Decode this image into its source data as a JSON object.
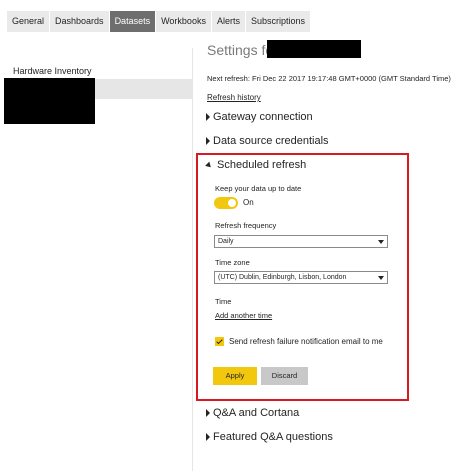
{
  "tabs": [
    {
      "label": "General"
    },
    {
      "label": "Dashboards"
    },
    {
      "label": "Datasets",
      "active": true
    },
    {
      "label": "Workbooks"
    },
    {
      "label": "Alerts"
    },
    {
      "label": "Subscriptions"
    }
  ],
  "sidebar": {
    "group_label": "Hardware Inventory"
  },
  "settings": {
    "title": "Settings for",
    "next_refresh": "Next refresh: Fri Dec 22 2017 19:17:48 GMT+0000 (GMT Standard Time)",
    "refresh_history": "Refresh history",
    "sections": {
      "gateway": "Gateway connection",
      "datasource": "Data source credentials",
      "scheduled": "Scheduled refresh",
      "qa": "Q&A and Cortana",
      "featured": "Featured Q&A questions"
    }
  },
  "scheduled_refresh": {
    "keep_label": "Keep your data up to date",
    "toggle_state": "On",
    "frequency_label": "Refresh frequency",
    "frequency_value": "Daily",
    "timezone_label": "Time zone",
    "timezone_value": "(UTC) Dublin, Edinburgh, Lisbon, London",
    "time_label": "Time",
    "add_time": "Add another time",
    "notify_label": "Send refresh failure notification email to me",
    "notify_checked": true,
    "apply_label": "Apply",
    "discard_label": "Discard"
  },
  "colors": {
    "accent": "#f2c80f",
    "highlight_border": "#d71920",
    "active_tab": "#6e6e6e"
  },
  "icons": {
    "collapsed": "triangle-right-icon",
    "expanded": "triangle-down-icon",
    "dropdown": "chevron-down-icon",
    "check": "checkmark-icon"
  }
}
